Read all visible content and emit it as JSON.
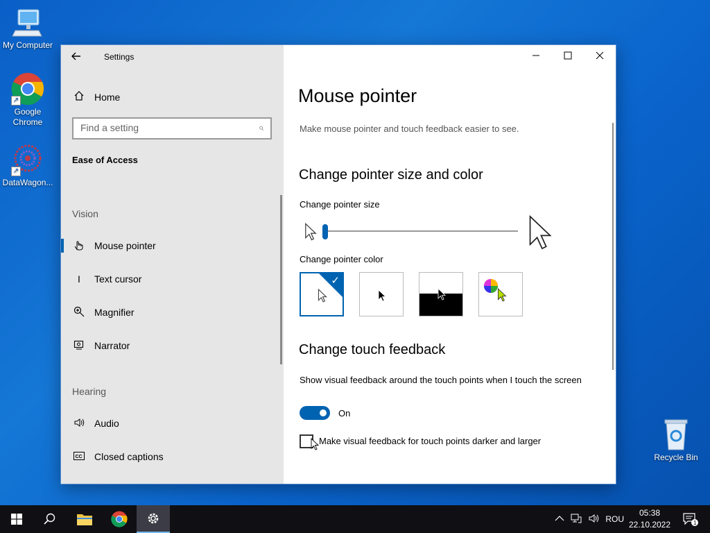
{
  "desktop": {
    "icons": [
      {
        "label": "My Computer"
      },
      {
        "label": "Google Chrome"
      },
      {
        "label": "DataWagon..."
      },
      {
        "label": "Recycle Bin"
      }
    ]
  },
  "window": {
    "app_title": "Settings",
    "controls": {
      "minimize": "—",
      "maximize": "☐",
      "close": "✕"
    }
  },
  "sidebar": {
    "home_label": "Home",
    "search_placeholder": "Find a setting",
    "section_title": "Ease of Access",
    "groups": [
      {
        "label": "Vision",
        "items": [
          {
            "label": "Mouse pointer",
            "icon": "mouse-pointer-icon",
            "active": true
          },
          {
            "label": "Text cursor",
            "icon": "text-cursor-icon"
          },
          {
            "label": "Magnifier",
            "icon": "magnifier-icon"
          },
          {
            "label": "Narrator",
            "icon": "narrator-icon"
          }
        ]
      },
      {
        "label": "Hearing",
        "items": [
          {
            "label": "Audio",
            "icon": "speaker-icon"
          },
          {
            "label": "Closed captions",
            "icon": "closed-captions-icon"
          }
        ]
      }
    ]
  },
  "main": {
    "title": "Mouse pointer",
    "description": "Make mouse pointer and touch feedback easier to see.",
    "pointer_section": {
      "heading": "Change pointer size and color",
      "size_label": "Change pointer size",
      "size_value": 1,
      "color_label": "Change pointer color",
      "color_options": [
        "white",
        "black",
        "inverted",
        "custom"
      ],
      "selected_color": "white"
    },
    "touch_section": {
      "heading": "Change touch feedback",
      "feedback_label": "Show visual feedback around the touch points when I touch the screen",
      "toggle_state": "On",
      "darker_label": "Make visual feedback for touch points darker and larger",
      "darker_checked": false
    }
  },
  "taskbar": {
    "tray_language": "ROU",
    "time": "05:38",
    "date": "22.10.2022",
    "notification_count": "1"
  },
  "colors": {
    "accent": "#0063b1",
    "sidebar_bg": "#e6e6e6",
    "taskbar_bg": "#0f0f14"
  }
}
